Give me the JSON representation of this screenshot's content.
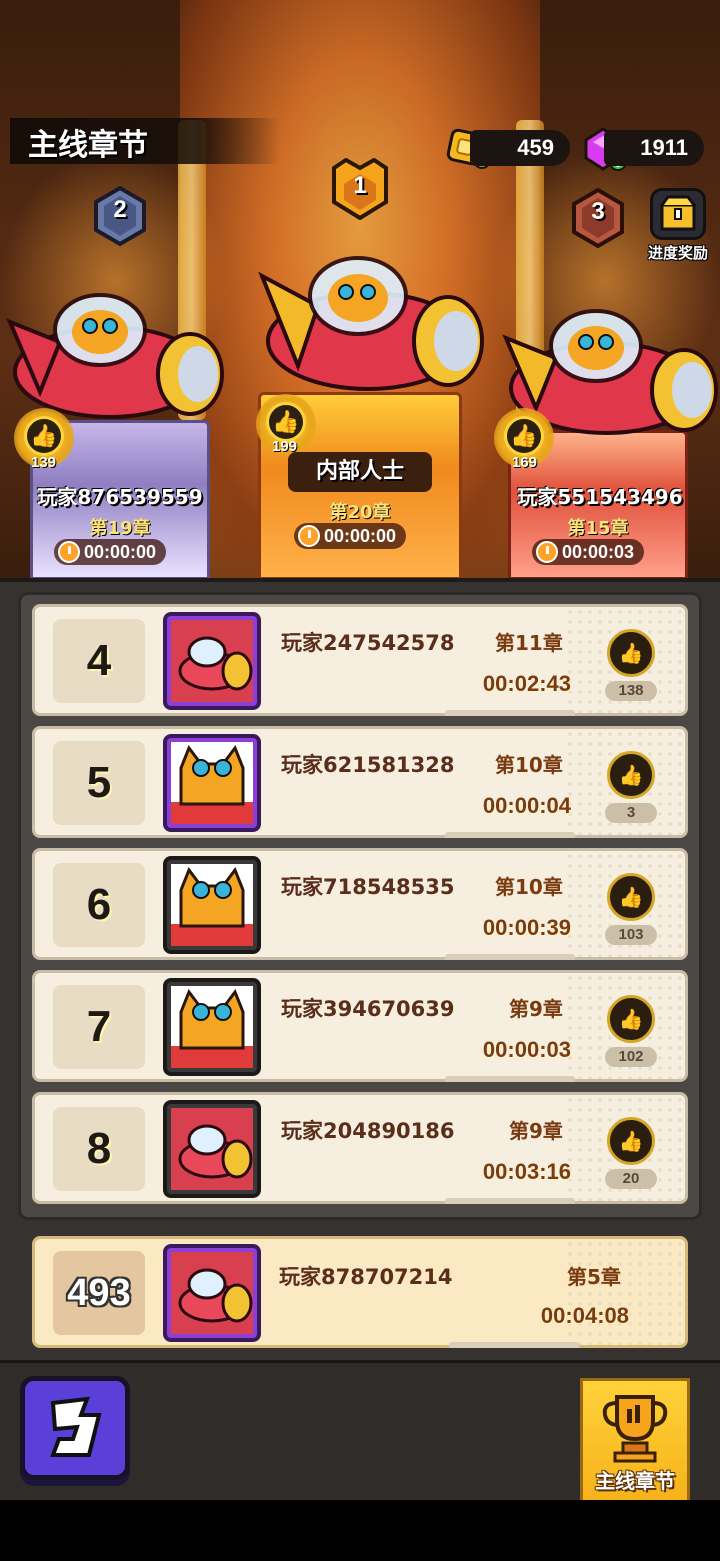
{
  "header": {
    "title": "主线章节",
    "gold": "459",
    "gems": "1911",
    "reward_label": "进度奖励"
  },
  "podium": [
    {
      "rank": "1",
      "name": "内部人士",
      "chapter": "第20章",
      "time": "00:00:00",
      "likes": "199"
    },
    {
      "rank": "2",
      "name": "玩家876539559",
      "chapter": "第19章",
      "time": "00:00:00",
      "likes": "139"
    },
    {
      "rank": "3",
      "name": "玩家551543496",
      "chapter": "第15章",
      "time": "00:00:03",
      "likes": "169"
    }
  ],
  "rows": [
    {
      "rank": "4",
      "name": "玩家247542578",
      "chapter": "第11章",
      "time": "00:02:43",
      "likes": "138"
    },
    {
      "rank": "5",
      "name": "玩家621581328",
      "chapter": "第10章",
      "time": "00:00:04",
      "likes": "3"
    },
    {
      "rank": "6",
      "name": "玩家718548535",
      "chapter": "第10章",
      "time": "00:00:39",
      "likes": "103"
    },
    {
      "rank": "7",
      "name": "玩家394670639",
      "chapter": "第9章",
      "time": "00:00:03",
      "likes": "102"
    },
    {
      "rank": "8",
      "name": "玩家204890186",
      "chapter": "第9章",
      "time": "00:03:16",
      "likes": "20"
    }
  ],
  "self": {
    "rank": "493",
    "name": "玩家878707214",
    "chapter": "第5章",
    "time": "00:04:08"
  },
  "bottom": {
    "tab_label": "主线章节"
  }
}
